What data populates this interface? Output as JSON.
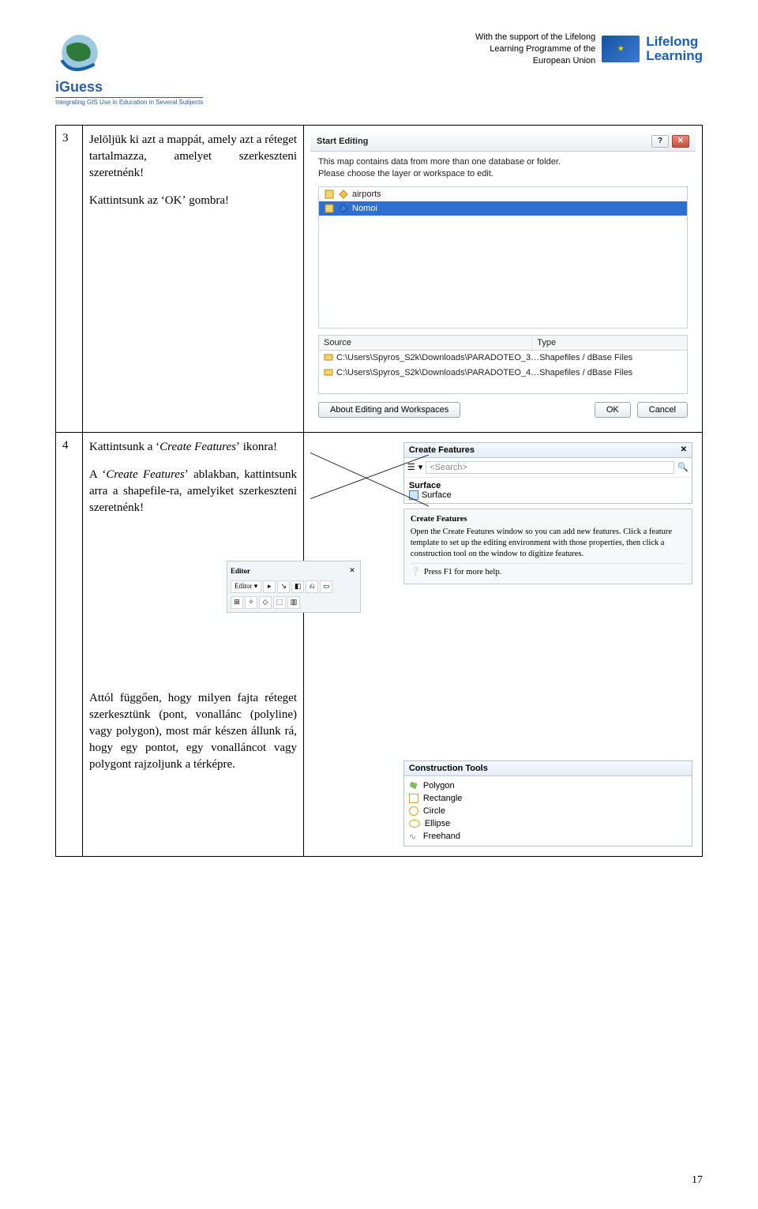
{
  "header": {
    "brand_name": "iGuess",
    "brand_tagline": "Integrating GIS Use in Education in Several Subjects",
    "eu_text_l1": "With the support of the Lifelong",
    "eu_text_l2": "Learning Programme of the",
    "eu_text_l3": "European Union",
    "lifelong_l1": "Lifelong",
    "lifelong_l2": "Learning"
  },
  "row3": {
    "num": "3",
    "p1_a": "Jelöljük ki azt a mappát, amely azt a réteget tartalmazza, amelyet szerkeszteni szeretnénk!",
    "p2_a": "Kattintsunk az ʻOKʼ gombra!"
  },
  "startEditing": {
    "title": "Start Editing",
    "help_btn": "?",
    "close_btn": "✕",
    "msg_l1": "This map contains data from more than one database or folder.",
    "msg_l2": "Please choose the layer or workspace to edit.",
    "layer_airports": "airports",
    "layer_nomoi": "Nomoi",
    "src_header": "Source",
    "type_header": "Type",
    "src1": "C:\\Users\\Spyros_S2k\\Downloads\\PARADOTEO_3…",
    "type1": "Shapefiles / dBase Files",
    "src2": "C:\\Users\\Spyros_S2k\\Downloads\\PARADOTEO_4…",
    "type2": "Shapefiles / dBase Files",
    "about_btn": "About Editing and Workspaces",
    "ok_btn": "OK",
    "cancel_btn": "Cancel"
  },
  "row4": {
    "num": "4",
    "p1_pre": "Kattintsunk a ʻ",
    "p1_em": "Create Features",
    "p1_post": "ʼ ikonra!",
    "p2_pre": "A ʻ",
    "p2_em": "Create Features",
    "p2_post": "ʼ ablakban, kattintsunk arra a shapefile-ra, amelyiket szerkeszteni szeretnénk!",
    "p3": "Attól függően, hogy milyen fajta réteget szerkesztünk (pont, vonallánc (polyline) vagy polygon), most már készen állunk rá, hogy egy pontot, egy vonalláncot vagy polygont rajzoljunk a térképre."
  },
  "createFeatures": {
    "title": "Create Features",
    "search_placeholder": "<Search>",
    "group_label": "Surface",
    "item_surface": "Surface",
    "editor_label": "Editor",
    "editor_menu": "Editor ▾",
    "tooltip_header": "Create Features",
    "tooltip_body": "Open the Create Features window so you can add new features. Click a feature template to set up the editing environment with those properties, then click a construction tool on the window to digitize features.",
    "tooltip_f1": "Press F1 for more help.",
    "ctools_title": "Construction Tools",
    "tool_polygon": "Polygon",
    "tool_rectangle": "Rectangle",
    "tool_circle": "Circle",
    "tool_ellipse": "Ellipse",
    "tool_freehand": "Freehand"
  },
  "page_number": "17"
}
